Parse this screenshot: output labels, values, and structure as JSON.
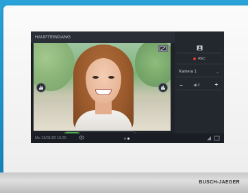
{
  "device": {
    "brand": "BUSCH-JAEGER"
  },
  "screen": {
    "title": "HAUPTEINGANG",
    "datetime": "Mo 13/01/20  10:20",
    "page_dots": {
      "count": 2,
      "active": 2
    }
  },
  "side_panel": {
    "rec_label": "REC",
    "camera_select": "Kamera 1",
    "volume_value": "4",
    "minus_label": "−",
    "plus_label": "+"
  },
  "icons": {
    "accept": "phone-icon",
    "door": "key-icon",
    "light": "bulb-icon",
    "mute": "mic-off-icon",
    "left": "hand-icon",
    "right": "hand-icon",
    "camera": "camera-switch-icon"
  },
  "colors": {
    "accept": "#4cae4c",
    "rec": "#e03a2e"
  }
}
